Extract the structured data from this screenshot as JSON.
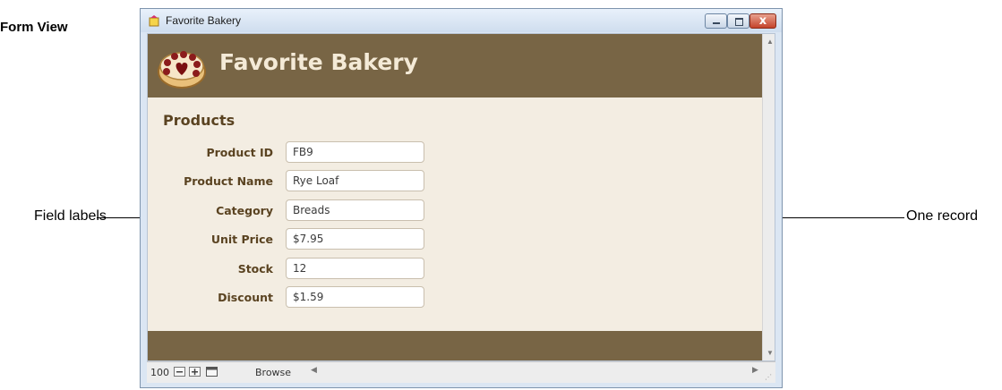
{
  "caption": "Form View",
  "callouts": {
    "left": "Field labels",
    "right": "One record"
  },
  "window": {
    "title": "Favorite Bakery",
    "close_glyph": "x"
  },
  "header": {
    "title": "Favorite Bakery",
    "logo_icon": "cake-icon"
  },
  "form": {
    "section_title": "Products",
    "fields": [
      {
        "label": "Product ID",
        "value": "FB9"
      },
      {
        "label": "Product Name",
        "value": "Rye Loaf"
      },
      {
        "label": "Category",
        "value": "Breads"
      },
      {
        "label": "Unit Price",
        "value": "$7.95"
      },
      {
        "label": "Stock",
        "value": "12"
      },
      {
        "label": "Discount",
        "value": "$1.59"
      }
    ]
  },
  "statusbar": {
    "zoom": "100",
    "mode": "Browse"
  },
  "colors": {
    "band": "#786545",
    "form_bg": "#f3ede2",
    "label": "#5a4321",
    "callout_line": "#1f5a8a"
  }
}
